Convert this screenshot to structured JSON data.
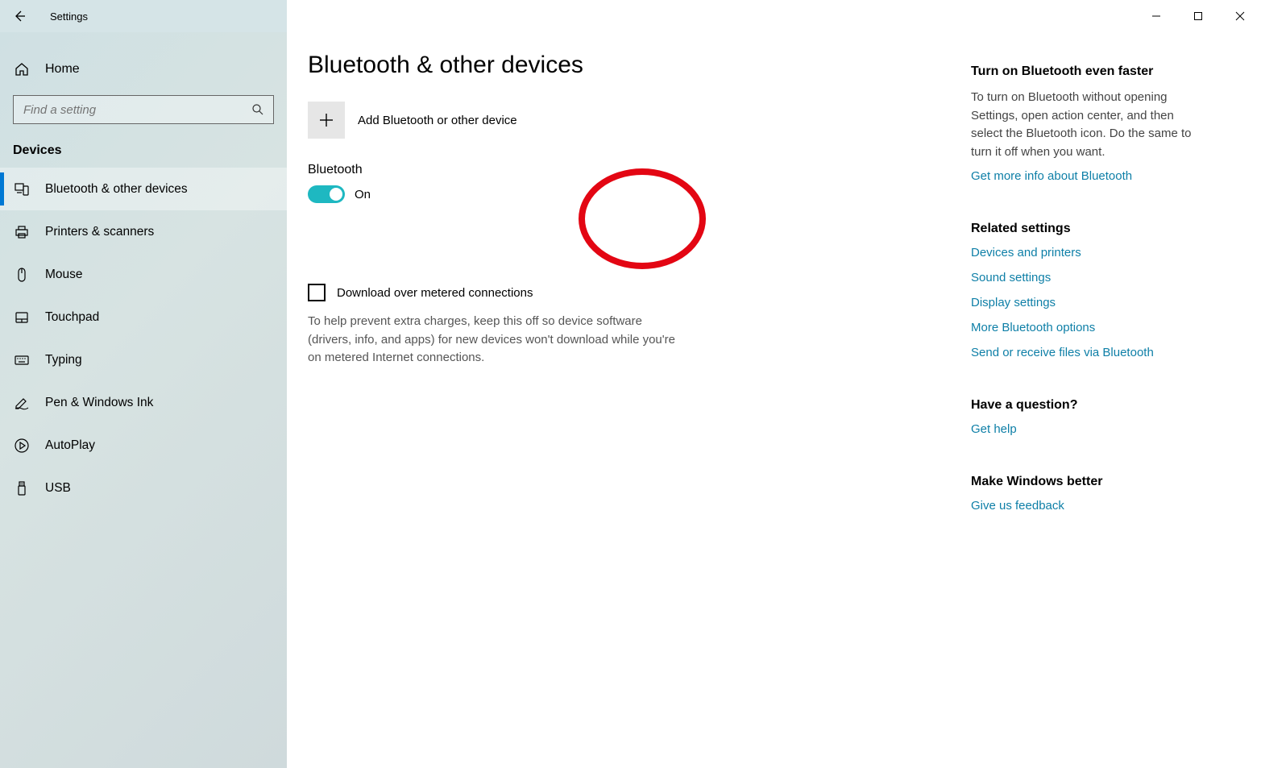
{
  "titlebar": {
    "title": "Settings"
  },
  "sidebar": {
    "home_label": "Home",
    "search_placeholder": "Find a setting",
    "section_label": "Devices",
    "items": [
      {
        "label": "Bluetooth & other devices"
      },
      {
        "label": "Printers & scanners"
      },
      {
        "label": "Mouse"
      },
      {
        "label": "Touchpad"
      },
      {
        "label": "Typing"
      },
      {
        "label": "Pen & Windows Ink"
      },
      {
        "label": "AutoPlay"
      },
      {
        "label": "USB"
      }
    ]
  },
  "page": {
    "title": "Bluetooth & other devices",
    "add_label": "Add Bluetooth or other device",
    "bt_label": "Bluetooth",
    "bt_state": "On",
    "metered_label": "Download over metered connections",
    "metered_desc": "To help prevent extra charges, keep this off so device software (drivers, info, and apps) for new devices won't download while you're on metered Internet connections."
  },
  "aside": {
    "tip_heading": "Turn on Bluetooth even faster",
    "tip_text": "To turn on Bluetooth without opening Settings, open action center, and then select the Bluetooth icon. Do the same to turn it off when you want.",
    "tip_link": "Get more info about Bluetooth",
    "related_heading": "Related settings",
    "related_links": [
      "Devices and printers",
      "Sound settings",
      "Display settings",
      "More Bluetooth options",
      "Send or receive files via Bluetooth"
    ],
    "question_heading": "Have a question?",
    "question_link": "Get help",
    "feedback_heading": "Make Windows better",
    "feedback_link": "Give us feedback"
  }
}
